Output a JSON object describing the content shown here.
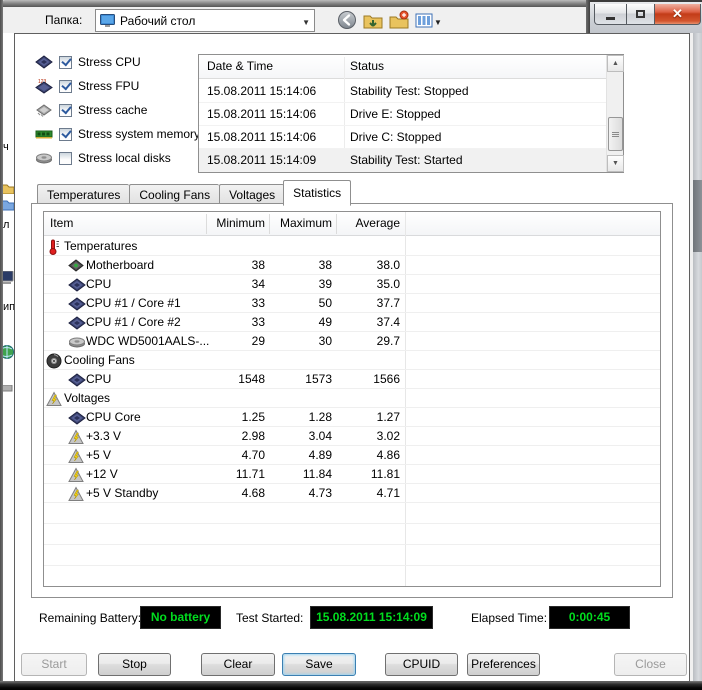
{
  "explorer_bar": {
    "folder_label": "Папка:",
    "folder_value": "Рабочий стол"
  },
  "window_controls": {
    "minimize": "minimize",
    "maximize": "maximize",
    "close": "close"
  },
  "stress_options": [
    {
      "label": "Stress CPU",
      "checked": true,
      "icon": "cpu-chip-icon"
    },
    {
      "label": "Stress FPU",
      "checked": true,
      "icon": "fpu-chip-icon"
    },
    {
      "label": "Stress cache",
      "checked": true,
      "icon": "cache-chip-icon"
    },
    {
      "label": "Stress system memory",
      "checked": true,
      "icon": "memory-module-icon"
    },
    {
      "label": "Stress local disks",
      "checked": false,
      "icon": "hard-disk-icon"
    }
  ],
  "log": {
    "columns": [
      "Date & Time",
      "Status"
    ],
    "rows": [
      {
        "datetime": "15.08.2011 15:14:06",
        "status": "Stability Test: Stopped",
        "selected": false
      },
      {
        "datetime": "15.08.2011 15:14:06",
        "status": "Drive E: Stopped",
        "selected": false
      },
      {
        "datetime": "15.08.2011 15:14:06",
        "status": "Drive C: Stopped",
        "selected": false
      },
      {
        "datetime": "15.08.2011 15:14:09",
        "status": "Stability Test: Started",
        "selected": true
      }
    ]
  },
  "tabs": [
    {
      "label": "Temperatures",
      "active": false
    },
    {
      "label": "Cooling Fans",
      "active": false
    },
    {
      "label": "Voltages",
      "active": false
    },
    {
      "label": "Statistics",
      "active": true
    }
  ],
  "statistics": {
    "columns": [
      "Item",
      "Minimum",
      "Maximum",
      "Average"
    ],
    "rows": [
      {
        "item": "Temperatures",
        "group": true,
        "icon": "thermometer-icon",
        "min": "",
        "max": "",
        "avg": ""
      },
      {
        "item": "Motherboard",
        "group": false,
        "icon": "motherboard-icon",
        "min": "38",
        "max": "38",
        "avg": "38.0"
      },
      {
        "item": "CPU",
        "group": false,
        "icon": "cpu-chip-icon",
        "min": "34",
        "max": "39",
        "avg": "35.0"
      },
      {
        "item": "CPU #1 / Core #1",
        "group": false,
        "icon": "cpu-chip-icon",
        "min": "33",
        "max": "50",
        "avg": "37.7"
      },
      {
        "item": "CPU #1 / Core #2",
        "group": false,
        "icon": "cpu-chip-icon",
        "min": "33",
        "max": "49",
        "avg": "37.4"
      },
      {
        "item": "WDC WD5001AALS-...",
        "group": false,
        "icon": "hard-disk-icon",
        "min": "29",
        "max": "30",
        "avg": "29.7"
      },
      {
        "item": "Cooling Fans",
        "group": true,
        "icon": "fan-icon",
        "min": "",
        "max": "",
        "avg": ""
      },
      {
        "item": "CPU",
        "group": false,
        "icon": "cpu-chip-icon",
        "min": "1548",
        "max": "1573",
        "avg": "1566"
      },
      {
        "item": "Voltages",
        "group": true,
        "icon": "voltage-icon",
        "min": "",
        "max": "",
        "avg": ""
      },
      {
        "item": "CPU Core",
        "group": false,
        "icon": "cpu-chip-icon",
        "min": "1.25",
        "max": "1.28",
        "avg": "1.27"
      },
      {
        "item": "+3.3 V",
        "group": false,
        "icon": "voltage-icon",
        "min": "2.98",
        "max": "3.04",
        "avg": "3.02"
      },
      {
        "item": "+5 V",
        "group": false,
        "icon": "voltage-icon",
        "min": "4.70",
        "max": "4.89",
        "avg": "4.86"
      },
      {
        "item": "+12 V",
        "group": false,
        "icon": "voltage-icon",
        "min": "11.71",
        "max": "11.84",
        "avg": "11.81"
      },
      {
        "item": "+5 V Standby",
        "group": false,
        "icon": "voltage-icon",
        "min": "4.68",
        "max": "4.73",
        "avg": "4.71"
      }
    ]
  },
  "status_bar": {
    "battery_label": "Remaining Battery:",
    "battery_value": "No battery",
    "test_started_label": "Test Started:",
    "test_started_value": "15.08.2011 15:14:09",
    "elapsed_label": "Elapsed Time:",
    "elapsed_value": "0:00:45",
    "lcd_background": "#000000",
    "lcd_text_color": "#00dd1e"
  },
  "buttons": [
    {
      "label": "Start",
      "enabled": false,
      "focused": false
    },
    {
      "label": "Stop",
      "enabled": true,
      "focused": false
    },
    {
      "label": "Clear",
      "enabled": true,
      "focused": false
    },
    {
      "label": "Save",
      "enabled": true,
      "focused": true
    },
    {
      "label": "CPUID",
      "enabled": true,
      "focused": false
    },
    {
      "label": "Preferences",
      "enabled": true,
      "focused": false
    },
    {
      "label": "Close",
      "enabled": false,
      "focused": false
    }
  ]
}
